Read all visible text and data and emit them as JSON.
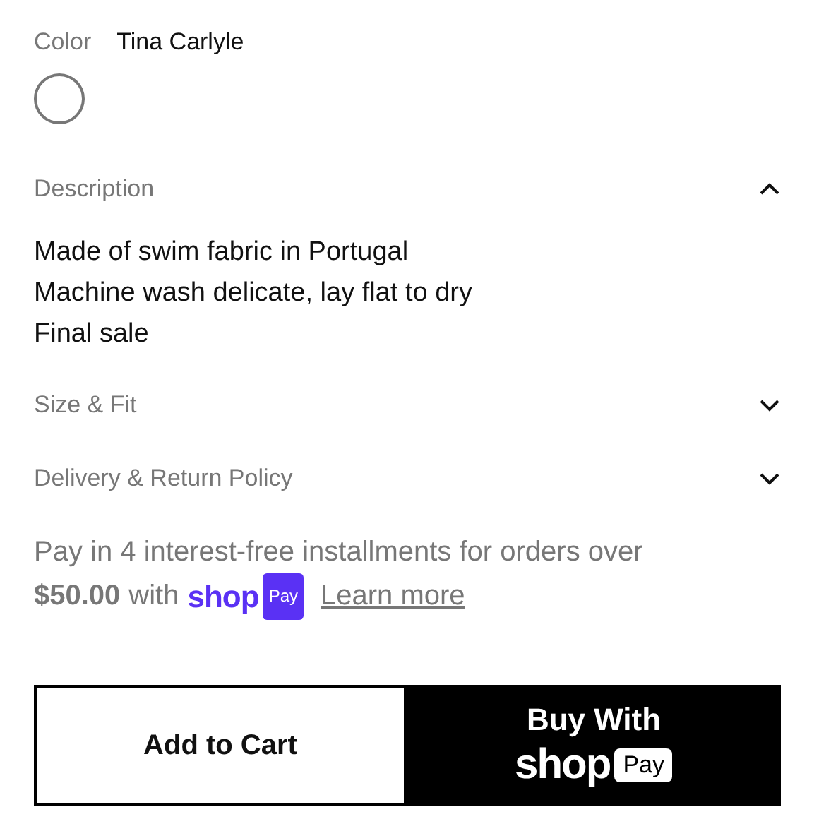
{
  "color_picker": {
    "label": "Color",
    "value": "Tina Carlyle",
    "swatches": [
      {
        "color": "#ffffff",
        "selected": true
      }
    ]
  },
  "accordions": [
    {
      "title": "Description",
      "expanded": true,
      "lines": [
        "Made of swim fabric in Portugal",
        "Machine wash delicate, lay flat to dry",
        "Final sale"
      ]
    },
    {
      "title": "Size & Fit",
      "expanded": false
    },
    {
      "title": "Delivery & Return Policy",
      "expanded": false
    }
  ],
  "installments": {
    "text": "Pay in 4 interest-free installments for orders over",
    "amount": "$50.00",
    "with": "with",
    "logo_word": "shop",
    "logo_badge": "Pay",
    "link": "Learn more"
  },
  "buttons": {
    "add_to_cart": "Add to Cart",
    "buy_with": "Buy With",
    "logo_word": "shop",
    "logo_badge": "Pay"
  }
}
